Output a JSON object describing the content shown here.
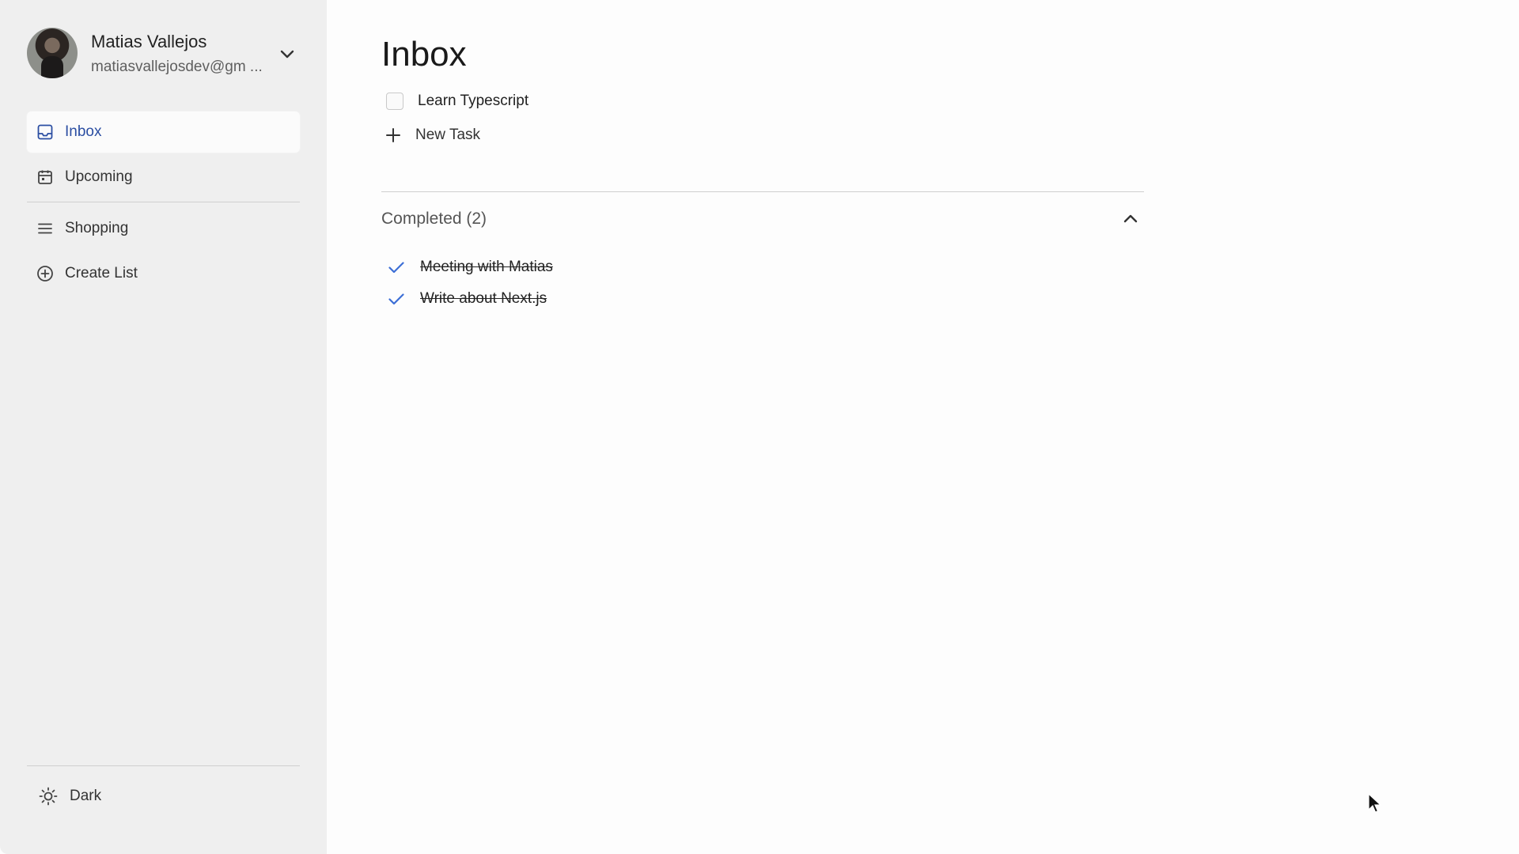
{
  "user": {
    "name": "Matias Vallejos",
    "email": "matiasvallejosdev@gm ..."
  },
  "sidebar": {
    "items": [
      {
        "label": "Inbox",
        "icon": "inbox-icon"
      },
      {
        "label": "Upcoming",
        "icon": "calendar-icon"
      }
    ],
    "lists": [
      {
        "label": "Shopping",
        "icon": "list-icon"
      }
    ],
    "create_list_label": "Create List",
    "theme_toggle_label": "Dark"
  },
  "main": {
    "title": "Inbox",
    "tasks": [
      {
        "label": "Learn Typescript",
        "done": false
      }
    ],
    "new_task_label": "New Task",
    "completed": {
      "title": "Completed (2)",
      "items": [
        {
          "label": "Meeting with Matias"
        },
        {
          "label": "Write about Next.js"
        }
      ]
    }
  },
  "colors": {
    "accent": "#2b4ea2",
    "check": "#3d6fd6",
    "sidebar_bg": "#efefef"
  }
}
